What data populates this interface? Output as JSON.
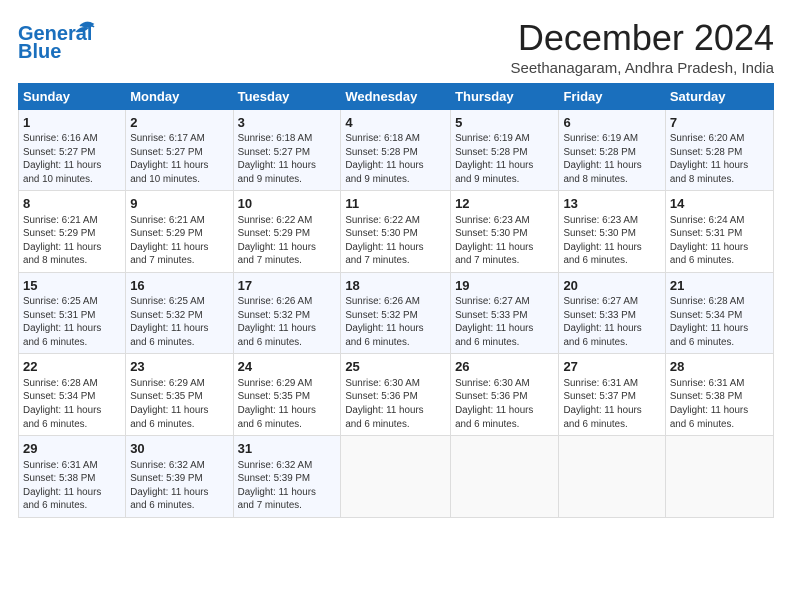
{
  "logo": {
    "line1": "General",
    "line2": "Blue"
  },
  "title": "December 2024",
  "subtitle": "Seethanagaram, Andhra Pradesh, India",
  "days_of_week": [
    "Sunday",
    "Monday",
    "Tuesday",
    "Wednesday",
    "Thursday",
    "Friday",
    "Saturday"
  ],
  "weeks": [
    [
      {
        "day": "1",
        "text": "Sunrise: 6:16 AM\nSunset: 5:27 PM\nDaylight: 11 hours\nand 10 minutes."
      },
      {
        "day": "2",
        "text": "Sunrise: 6:17 AM\nSunset: 5:27 PM\nDaylight: 11 hours\nand 10 minutes."
      },
      {
        "day": "3",
        "text": "Sunrise: 6:18 AM\nSunset: 5:27 PM\nDaylight: 11 hours\nand 9 minutes."
      },
      {
        "day": "4",
        "text": "Sunrise: 6:18 AM\nSunset: 5:28 PM\nDaylight: 11 hours\nand 9 minutes."
      },
      {
        "day": "5",
        "text": "Sunrise: 6:19 AM\nSunset: 5:28 PM\nDaylight: 11 hours\nand 9 minutes."
      },
      {
        "day": "6",
        "text": "Sunrise: 6:19 AM\nSunset: 5:28 PM\nDaylight: 11 hours\nand 8 minutes."
      },
      {
        "day": "7",
        "text": "Sunrise: 6:20 AM\nSunset: 5:28 PM\nDaylight: 11 hours\nand 8 minutes."
      }
    ],
    [
      {
        "day": "8",
        "text": "Sunrise: 6:21 AM\nSunset: 5:29 PM\nDaylight: 11 hours\nand 8 minutes."
      },
      {
        "day": "9",
        "text": "Sunrise: 6:21 AM\nSunset: 5:29 PM\nDaylight: 11 hours\nand 7 minutes."
      },
      {
        "day": "10",
        "text": "Sunrise: 6:22 AM\nSunset: 5:29 PM\nDaylight: 11 hours\nand 7 minutes."
      },
      {
        "day": "11",
        "text": "Sunrise: 6:22 AM\nSunset: 5:30 PM\nDaylight: 11 hours\nand 7 minutes."
      },
      {
        "day": "12",
        "text": "Sunrise: 6:23 AM\nSunset: 5:30 PM\nDaylight: 11 hours\nand 7 minutes."
      },
      {
        "day": "13",
        "text": "Sunrise: 6:23 AM\nSunset: 5:30 PM\nDaylight: 11 hours\nand 6 minutes."
      },
      {
        "day": "14",
        "text": "Sunrise: 6:24 AM\nSunset: 5:31 PM\nDaylight: 11 hours\nand 6 minutes."
      }
    ],
    [
      {
        "day": "15",
        "text": "Sunrise: 6:25 AM\nSunset: 5:31 PM\nDaylight: 11 hours\nand 6 minutes."
      },
      {
        "day": "16",
        "text": "Sunrise: 6:25 AM\nSunset: 5:32 PM\nDaylight: 11 hours\nand 6 minutes."
      },
      {
        "day": "17",
        "text": "Sunrise: 6:26 AM\nSunset: 5:32 PM\nDaylight: 11 hours\nand 6 minutes."
      },
      {
        "day": "18",
        "text": "Sunrise: 6:26 AM\nSunset: 5:32 PM\nDaylight: 11 hours\nand 6 minutes."
      },
      {
        "day": "19",
        "text": "Sunrise: 6:27 AM\nSunset: 5:33 PM\nDaylight: 11 hours\nand 6 minutes."
      },
      {
        "day": "20",
        "text": "Sunrise: 6:27 AM\nSunset: 5:33 PM\nDaylight: 11 hours\nand 6 minutes."
      },
      {
        "day": "21",
        "text": "Sunrise: 6:28 AM\nSunset: 5:34 PM\nDaylight: 11 hours\nand 6 minutes."
      }
    ],
    [
      {
        "day": "22",
        "text": "Sunrise: 6:28 AM\nSunset: 5:34 PM\nDaylight: 11 hours\nand 6 minutes."
      },
      {
        "day": "23",
        "text": "Sunrise: 6:29 AM\nSunset: 5:35 PM\nDaylight: 11 hours\nand 6 minutes."
      },
      {
        "day": "24",
        "text": "Sunrise: 6:29 AM\nSunset: 5:35 PM\nDaylight: 11 hours\nand 6 minutes."
      },
      {
        "day": "25",
        "text": "Sunrise: 6:30 AM\nSunset: 5:36 PM\nDaylight: 11 hours\nand 6 minutes."
      },
      {
        "day": "26",
        "text": "Sunrise: 6:30 AM\nSunset: 5:36 PM\nDaylight: 11 hours\nand 6 minutes."
      },
      {
        "day": "27",
        "text": "Sunrise: 6:31 AM\nSunset: 5:37 PM\nDaylight: 11 hours\nand 6 minutes."
      },
      {
        "day": "28",
        "text": "Sunrise: 6:31 AM\nSunset: 5:38 PM\nDaylight: 11 hours\nand 6 minutes."
      }
    ],
    [
      {
        "day": "29",
        "text": "Sunrise: 6:31 AM\nSunset: 5:38 PM\nDaylight: 11 hours\nand 6 minutes."
      },
      {
        "day": "30",
        "text": "Sunrise: 6:32 AM\nSunset: 5:39 PM\nDaylight: 11 hours\nand 6 minutes."
      },
      {
        "day": "31",
        "text": "Sunrise: 6:32 AM\nSunset: 5:39 PM\nDaylight: 11 hours\nand 7 minutes."
      },
      {
        "day": "",
        "text": ""
      },
      {
        "day": "",
        "text": ""
      },
      {
        "day": "",
        "text": ""
      },
      {
        "day": "",
        "text": ""
      }
    ]
  ]
}
